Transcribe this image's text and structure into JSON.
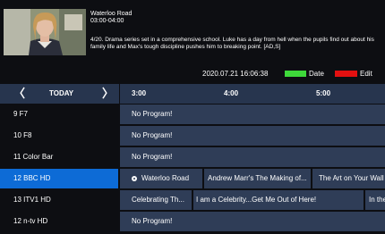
{
  "info": {
    "title": "Waterloo Road",
    "time": "03:00-04:00",
    "description": "4/20. Drama series set in a comprehensive school. Luke has a day from hell when the pupils find out about his family life and Max's tough discipline pushes him to breaking point. [AD,S]"
  },
  "status": {
    "datetime": "2020.07.21  16:06:38",
    "date_key_label": "Date",
    "edit_key_label": "Edit",
    "date_key_color": "#3ed93a",
    "edit_key_color": "#e31010"
  },
  "grid_header": {
    "prev_icon": "chevron-left-icon",
    "next_icon": "chevron-right-icon",
    "prev_glyph": "〈",
    "next_glyph": "〉",
    "day_label": "TODAY",
    "times": [
      "3:00",
      "4:00",
      "5:00"
    ]
  },
  "channels": [
    {
      "label": "9  F7",
      "selected": false,
      "programs": [
        "No Program!"
      ]
    },
    {
      "label": "10  F8",
      "selected": false,
      "programs": [
        "No Program!"
      ]
    },
    {
      "label": "11  Color Bar",
      "selected": false,
      "programs": [
        "No Program!"
      ]
    },
    {
      "label": "12  BBC HD",
      "selected": true,
      "programs": [
        "Waterloo Road",
        "Andrew Marr's The Making of...",
        "The Art on Your Wall"
      ]
    },
    {
      "label": "13  ITV1 HD",
      "selected": false,
      "programs": [
        "Celebrating Th...",
        "I am a Celebrity...Get Me Out of Here!",
        "In the"
      ]
    },
    {
      "label": "12  n-tv HD",
      "selected": false,
      "programs": [
        "No Program!"
      ]
    }
  ],
  "colors": {
    "background": "#0d0e12",
    "header_bar": "#27354e",
    "program_cell": "#2f3d57",
    "selected_channel": "#0d6bd6"
  }
}
